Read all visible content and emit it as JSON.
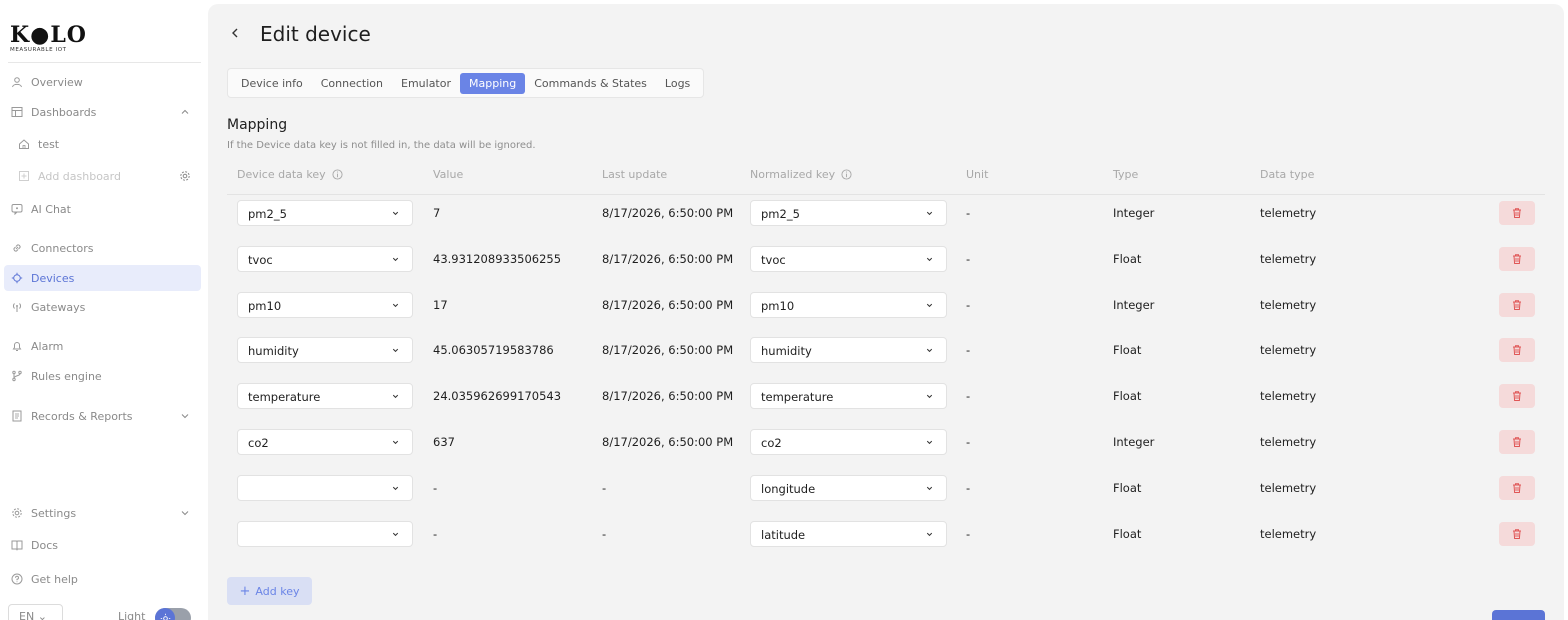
{
  "brand": {
    "name": "K●LO",
    "tagline": "MEASURABLE IOT"
  },
  "sidebar": {
    "items": [
      {
        "label": "Overview",
        "icon": "user-icon"
      },
      {
        "label": "Dashboards",
        "icon": "layout-icon"
      },
      {
        "label": "test",
        "icon": "home-icon"
      },
      {
        "label": "Add dashboard",
        "icon": "plus-square-icon"
      },
      {
        "label": "AI Chat",
        "icon": "chat-icon"
      },
      {
        "label": "Connectors",
        "icon": "link-icon"
      },
      {
        "label": "Devices",
        "icon": "chip-icon"
      },
      {
        "label": "Gateways",
        "icon": "antenna-icon"
      },
      {
        "label": "Alarm",
        "icon": "bell-icon"
      },
      {
        "label": "Rules engine",
        "icon": "branch-icon"
      },
      {
        "label": "Records & Reports",
        "icon": "report-icon"
      },
      {
        "label": "Settings",
        "icon": "gear-icon"
      },
      {
        "label": "Docs",
        "icon": "book-icon"
      },
      {
        "label": "Get help",
        "icon": "help-icon"
      }
    ],
    "language": "EN",
    "theme_label": "Light"
  },
  "page": {
    "title": "Edit device",
    "tabs": [
      "Device info",
      "Connection",
      "Emulator",
      "Mapping",
      "Commands & States",
      "Logs"
    ],
    "active_tab": "Mapping"
  },
  "mapping": {
    "title": "Mapping",
    "description": "If the Device data key is not filled in, the data will be ignored.",
    "columns": [
      "Device data key",
      "Value",
      "Last update",
      "Normalized key",
      "Unit",
      "Type",
      "Data type"
    ],
    "rows": [
      {
        "device_key": "pm2_5",
        "value": "7",
        "last_update": "8/17/2026, 6:50:00 PM",
        "normalized_key": "pm2_5",
        "unit": "-",
        "type": "Integer",
        "data_type": "telemetry"
      },
      {
        "device_key": "tvoc",
        "value": "43.931208933506255",
        "last_update": "8/17/2026, 6:50:00 PM",
        "normalized_key": "tvoc",
        "unit": "-",
        "type": "Float",
        "data_type": "telemetry"
      },
      {
        "device_key": "pm10",
        "value": "17",
        "last_update": "8/17/2026, 6:50:00 PM",
        "normalized_key": "pm10",
        "unit": "-",
        "type": "Integer",
        "data_type": "telemetry"
      },
      {
        "device_key": "humidity",
        "value": "45.06305719583786",
        "last_update": "8/17/2026, 6:50:00 PM",
        "normalized_key": "humidity",
        "unit": "-",
        "type": "Float",
        "data_type": "telemetry"
      },
      {
        "device_key": "temperature",
        "value": "24.035962699170543",
        "last_update": "8/17/2026, 6:50:00 PM",
        "normalized_key": "temperature",
        "unit": "-",
        "type": "Float",
        "data_type": "telemetry"
      },
      {
        "device_key": "co2",
        "value": "637",
        "last_update": "8/17/2026, 6:50:00 PM",
        "normalized_key": "co2",
        "unit": "-",
        "type": "Integer",
        "data_type": "telemetry"
      },
      {
        "device_key": "",
        "value": "-",
        "last_update": "-",
        "normalized_key": "longitude",
        "unit": "-",
        "type": "Float",
        "data_type": "telemetry"
      },
      {
        "device_key": "",
        "value": "-",
        "last_update": "-",
        "normalized_key": "latitude",
        "unit": "-",
        "type": "Float",
        "data_type": "telemetry"
      }
    ],
    "add_key_label": "Add key"
  },
  "colors": {
    "accent": "#6a84e6",
    "active_nav_bg": "#e8ecfb",
    "delete_bg": "#f5dada",
    "delete_icon": "#e05555"
  }
}
